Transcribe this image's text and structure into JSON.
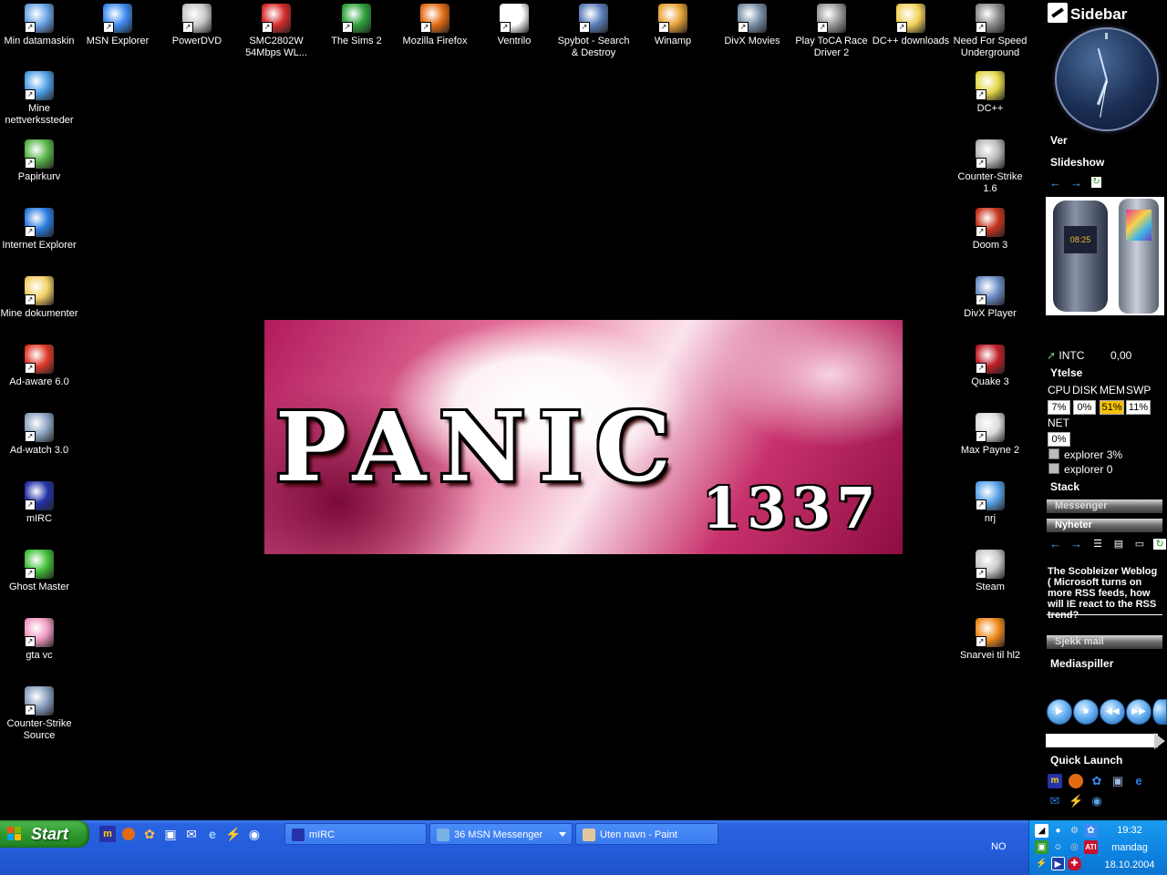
{
  "desktop": {
    "icons_top": [
      {
        "label": "Min datamaskin",
        "icon": "my-computer-icon",
        "color": "#6aa4e6"
      },
      {
        "label": "MSN Explorer",
        "icon": "msn-butterfly-icon",
        "color": "#3d8bf0"
      },
      {
        "label": "PowerDVD",
        "icon": "dvd-disc-icon",
        "color": "#c9c9c9"
      },
      {
        "label": "SMC2802W 54Mbps WL...",
        "icon": "network-icon",
        "color": "#d62b2b"
      },
      {
        "label": "The Sims 2",
        "icon": "sims-plumbob-icon",
        "color": "#2da23a"
      },
      {
        "label": "Mozilla Firefox",
        "icon": "firefox-icon",
        "color": "#e36b12"
      },
      {
        "label": "Ventrilo",
        "icon": "ventrilo-icon",
        "color": "#ffffff"
      },
      {
        "label": "Spybot - Search & Destroy",
        "icon": "spybot-icon",
        "color": "#5b7fb9"
      },
      {
        "label": "Winamp",
        "icon": "winamp-icon",
        "color": "#e8a236"
      },
      {
        "label": "DivX Movies",
        "icon": "divx-movies-icon",
        "color": "#7a8ea8"
      },
      {
        "label": "Play ToCA Race Driver 2",
        "icon": "toca-race-icon",
        "color": "#9a9a9a"
      },
      {
        "label": "DC++ downloads",
        "icon": "folder-icon",
        "color": "#f3d25a"
      },
      {
        "label": "Need For Speed Underground",
        "icon": "nfs-wheel-icon",
        "color": "#8d8d8d"
      }
    ],
    "icons_left": [
      {
        "label": "Mine nettverkssteder",
        "icon": "network-places-icon",
        "color": "#4fa0e8"
      },
      {
        "label": "Papirkurv",
        "icon": "recycle-bin-icon",
        "color": "#5ab54a"
      },
      {
        "label": "Internet Explorer",
        "icon": "internet-explorer-icon",
        "color": "#2b7de0"
      },
      {
        "label": "Mine dokumenter",
        "icon": "my-documents-icon",
        "color": "#f2d065"
      },
      {
        "label": "Ad-aware 6.0",
        "icon": "ad-aware-icon",
        "color": "#e03a2a"
      },
      {
        "label": "Ad-watch 3.0",
        "icon": "ad-watch-icon",
        "color": "#8fa6c4"
      },
      {
        "label": "mIRC",
        "icon": "mirc-icon",
        "color": "#2533a8"
      },
      {
        "label": "Ghost Master",
        "icon": "ghost-master-icon",
        "color": "#43c23a"
      },
      {
        "label": "gta vc",
        "icon": "gta-vc-icon",
        "color": "#f09ac2"
      },
      {
        "label": "Counter-Strike Source",
        "icon": "counter-strike-source-icon",
        "color": "#8aa0c0"
      }
    ],
    "icons_right": [
      {
        "label": "DC++",
        "icon": "dcpp-icon",
        "color": "#e3d84a"
      },
      {
        "label": "Counter-Strike 1.6",
        "icon": "counter-strike-icon",
        "color": "#b9b9b9"
      },
      {
        "label": "Doom 3",
        "icon": "doom3-pentagram-icon",
        "color": "#c8351f"
      },
      {
        "label": "DivX Player",
        "icon": "divx-player-icon",
        "color": "#6b8fc6"
      },
      {
        "label": "Quake 3",
        "icon": "quake3-icon",
        "color": "#c0202a"
      },
      {
        "label": "Max Payne 2",
        "icon": "max-payne-icon",
        "color": "#dcdcdc"
      },
      {
        "label": "nrj",
        "icon": "nrj-media-icon",
        "color": "#5aa4e8"
      },
      {
        "label": "Steam",
        "icon": "steam-icon",
        "color": "#c9c9c9"
      },
      {
        "label": "Snarvei til hl2",
        "icon": "half-life2-icon",
        "color": "#f08a1c"
      }
    ],
    "wallpaper": {
      "line1": "PANIC",
      "line2": "1337"
    }
  },
  "sidebar": {
    "title": "Sidebar",
    "weather_heading": "Ver",
    "slideshow_heading": "Slideshow",
    "stock": {
      "symbol": "INTC",
      "value": "0,00"
    },
    "perf_heading": "Ytelse",
    "perf_labels": {
      "cpu": "CPU",
      "disk": "DISK",
      "mem": "MEM",
      "swp": "SWP",
      "net": "NET"
    },
    "perf_values": {
      "cpu": "7%",
      "disk": "0%",
      "mem": "51%",
      "swp": "11%",
      "net": "0%"
    },
    "processes": [
      "explorer 3%",
      "explorer 0"
    ],
    "stack_heading": "Stack",
    "messenger_bar": "Messenger",
    "news_bar": "Nyheter",
    "news_text": "The Scobleizer Weblog ( Microsoft turns on more RSS feeds, how will IE react to the RSS trend?",
    "mail_bar": "Sjekk mail",
    "media_heading": "Mediaspiller",
    "quicklaunch_heading": "Quick Launch"
  },
  "taskbar": {
    "start_label": "Start",
    "tasks": [
      {
        "label": "mIRC",
        "icon": "mirc-icon"
      },
      {
        "label": "36 MSN Messenger",
        "icon": "msn-messenger-icon"
      },
      {
        "label": "Uten navn - Paint",
        "icon": "paint-icon"
      }
    ],
    "language": "NO",
    "clock": {
      "time": "19:32",
      "day": "mandag",
      "date": "18.10.2004"
    }
  }
}
